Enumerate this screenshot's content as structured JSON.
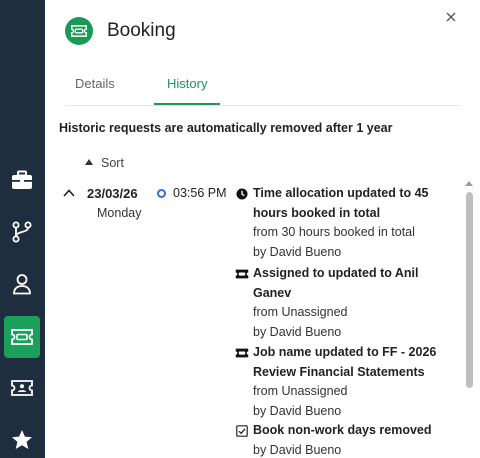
{
  "rail": {
    "items": [
      {
        "icon": "briefcase-icon"
      },
      {
        "icon": "branch-icon"
      },
      {
        "icon": "person-icon"
      },
      {
        "icon": "ticket-icon",
        "active": true
      },
      {
        "icon": "ticket-person-icon"
      },
      {
        "icon": "star-icon"
      }
    ]
  },
  "header": {
    "title": "Booking",
    "icon": "ticket-icon"
  },
  "tabs": [
    {
      "label": "Details",
      "active": false
    },
    {
      "label": "History",
      "active": true
    }
  ],
  "notice": "Historic requests are automatically removed after 1 year",
  "sort": {
    "label": "Sort"
  },
  "history": {
    "date": "23/03/26",
    "weekday": "Monday",
    "time": "03:56 PM",
    "entries": [
      {
        "icon": "clock-icon",
        "head1": "Time allocation updated to 45",
        "head2": "hours booked in total",
        "from": "from 30 hours booked in total",
        "by": "by David Bueno"
      },
      {
        "icon": "ticket-icon",
        "head1": "Assigned to updated to Anil",
        "head2": "Ganev",
        "from": "from Unassigned",
        "by": "by David Bueno"
      },
      {
        "icon": "ticket-icon",
        "head1": "Job name updated to FF - 2026",
        "head2": "Review Financial Statements",
        "from": "from Unassigned",
        "by": "by David Bueno"
      },
      {
        "icon": "checkbox-icon",
        "head1": "Book non-work days removed",
        "by": "by David Bueno"
      }
    ]
  },
  "colors": {
    "rail": "#1f2e3f",
    "accent": "#1a9a55",
    "time_dot": "#2f6fd6"
  }
}
